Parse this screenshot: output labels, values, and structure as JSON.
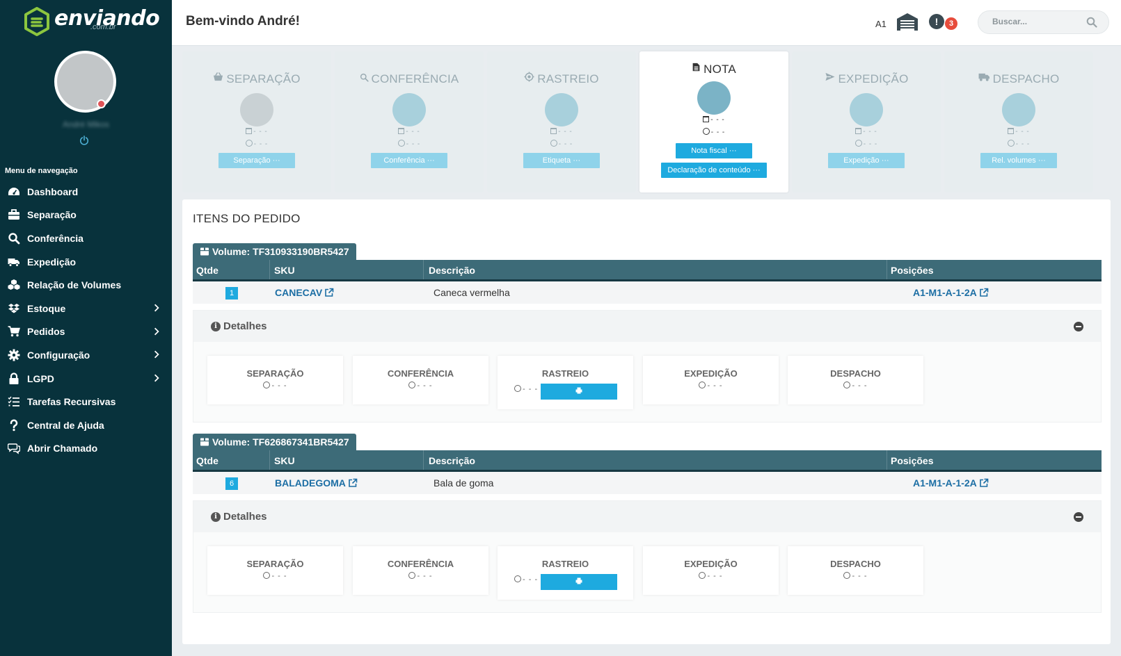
{
  "brand": {
    "name": "enviando",
    "domain": ".com.br",
    "accent": "#1eaadf",
    "sidebar_bg": "#08323c"
  },
  "user": {
    "name": "André Mikos"
  },
  "nav": {
    "title": "Menu de navegação",
    "items": [
      {
        "label": "Dashboard",
        "icon": "dashboard-icon",
        "has_children": false
      },
      {
        "label": "Separação",
        "icon": "briefcase-icon",
        "has_children": false
      },
      {
        "label": "Conferência",
        "icon": "search-icon",
        "has_children": false
      },
      {
        "label": "Expedição",
        "icon": "truck-icon",
        "has_children": false
      },
      {
        "label": "Relação de Volumes",
        "icon": "cubes-icon",
        "has_children": false
      },
      {
        "label": "Estoque",
        "icon": "dropbox-icon",
        "has_children": true
      },
      {
        "label": "Pedidos",
        "icon": "cart-icon",
        "has_children": true
      },
      {
        "label": "Configuração",
        "icon": "gear-icon",
        "has_children": true
      },
      {
        "label": "LGPD",
        "icon": "lock-icon",
        "has_children": true
      },
      {
        "label": "Tarefas Recursivas",
        "icon": "tasks-icon",
        "has_children": false
      },
      {
        "label": "Central de Ajuda",
        "icon": "question-icon",
        "has_children": false
      },
      {
        "label": "Abrir Chamado",
        "icon": "chat-icon",
        "has_children": false
      }
    ]
  },
  "topbar": {
    "welcome": "Bem-vindo André!",
    "warehouse_code": "A1",
    "alert_symbol": "!",
    "alert_count": "3",
    "search_placeholder": "Buscar..."
  },
  "stages": [
    {
      "title": "SEPARAÇÃO",
      "icon": "basket-icon",
      "date": "- - -",
      "time": "- - -",
      "button": "Separação ···",
      "state": "grey"
    },
    {
      "title": "CONFERÊNCIA",
      "icon": "search-icon",
      "date": "- - -",
      "time": "- - -",
      "button": "Conferência ···",
      "state": "pending"
    },
    {
      "title": "RASTREIO",
      "icon": "crosshair-icon",
      "date": "- - -",
      "time": "- - -",
      "button": "Etiqueta ···",
      "state": "pending"
    },
    {
      "title": "NOTA",
      "icon": "file-icon",
      "date": "- - -",
      "time": "- - -",
      "button": "Nota fiscal ···",
      "button2": "Declaração de conteúdo ···",
      "state": "active"
    },
    {
      "title": "EXPEDIÇÃO",
      "icon": "send-icon",
      "date": "- - -",
      "time": "- - -",
      "button": "Expedição ···",
      "state": "pending"
    },
    {
      "title": "DESPACHO",
      "icon": "truck-icon",
      "date": "- - -",
      "time": "- - -",
      "button": "Rel. volumes ···",
      "state": "pending"
    }
  ],
  "items": {
    "title": "ITENS DO PEDIDO",
    "columns": [
      "Qtde",
      "SKU",
      "Descrição",
      "Posições"
    ],
    "details_label": "Detalhes",
    "volumes": [
      {
        "label": "Volume: TF310933190BR5427",
        "row": {
          "qty": "1",
          "sku": "CANECAV",
          "description": "Caneca vermelha",
          "position": "A1-M1-A-1-2A"
        },
        "steps": [
          {
            "name": "SEPARAÇÃO",
            "time": "- - -"
          },
          {
            "name": "CONFERÊNCIA",
            "time": "- - -"
          },
          {
            "name": "RASTREIO",
            "time": "- - -",
            "has_print": true
          },
          {
            "name": "EXPEDIÇÃO",
            "time": "- - -"
          },
          {
            "name": "DESPACHO",
            "time": "- - -"
          }
        ]
      },
      {
        "label": "Volume: TF626867341BR5427",
        "row": {
          "qty": "6",
          "sku": "BALADEGOMA",
          "description": "Bala de goma",
          "position": "A1-M1-A-1-2A"
        },
        "steps": [
          {
            "name": "SEPARAÇÃO",
            "time": "- - -"
          },
          {
            "name": "CONFERÊNCIA",
            "time": "- - -"
          },
          {
            "name": "RASTREIO",
            "time": "- - -",
            "has_print": true
          },
          {
            "name": "EXPEDIÇÃO",
            "time": "- - -"
          },
          {
            "name": "DESPACHO",
            "time": "- - -"
          }
        ]
      }
    ]
  }
}
